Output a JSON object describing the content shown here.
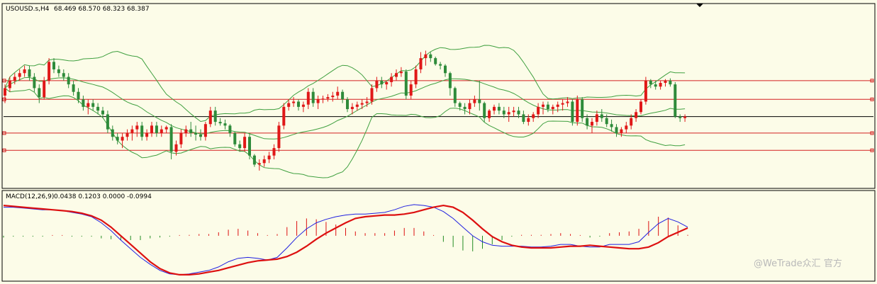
{
  "header": {
    "symbol": "USOUSD.s,H4",
    "ohlc": "68.469 68.570 68.323 68.387"
  },
  "indicator": {
    "title": "MACD(12,26,9)",
    "values": "0.0438 0.1203 0.0000 -0.0994"
  },
  "watermark": {
    "text": "@WeTrade众汇 官方"
  },
  "colors": {
    "background": "#fcfce8",
    "bull": "#e01818",
    "bear": "#2e8b3a",
    "bollinger": "#40a040",
    "level_line": "#d42020",
    "current_line": "#000000",
    "macd_main": "#2020e0",
    "macd_signal": "#dd1010",
    "hist_pos": "#dd1010",
    "hist_neg": "#228b22"
  },
  "chart_data": [
    {
      "type": "candlestick",
      "title": "USOUSD.s,H4",
      "ylim": [
        67.6,
        70.0
      ],
      "levels": [
        69.0,
        68.75,
        68.3,
        68.07
      ],
      "current_price": 68.52,
      "candles": [
        [
          68.8,
          68.95,
          68.7,
          68.9
        ],
        [
          68.9,
          69.05,
          68.85,
          69.0
        ],
        [
          69.0,
          69.1,
          68.95,
          69.05
        ],
        [
          69.05,
          69.15,
          69.0,
          69.1
        ],
        [
          69.1,
          69.2,
          69.05,
          69.15
        ],
        [
          69.15,
          69.2,
          69.0,
          69.05
        ],
        [
          69.05,
          69.1,
          68.85,
          68.9
        ],
        [
          68.9,
          68.95,
          68.7,
          68.78
        ],
        [
          68.78,
          69.05,
          68.75,
          69.0
        ],
        [
          69.0,
          69.3,
          68.95,
          69.25
        ],
        [
          69.25,
          69.3,
          69.1,
          69.15
        ],
        [
          69.15,
          69.2,
          69.05,
          69.1
        ],
        [
          69.1,
          69.15,
          69.0,
          69.05
        ],
        [
          69.05,
          69.1,
          68.9,
          68.95
        ],
        [
          68.95,
          69.0,
          68.8,
          68.85
        ],
        [
          68.85,
          68.9,
          68.7,
          68.75
        ],
        [
          68.75,
          68.8,
          68.6,
          68.65
        ],
        [
          68.65,
          68.75,
          68.55,
          68.7
        ],
        [
          68.7,
          68.75,
          68.6,
          68.65
        ],
        [
          68.65,
          68.7,
          68.55,
          68.6
        ],
        [
          68.6,
          68.65,
          68.5,
          68.55
        ],
        [
          68.55,
          68.6,
          68.3,
          68.35
        ],
        [
          68.35,
          68.4,
          68.2,
          68.25
        ],
        [
          68.25,
          68.3,
          68.15,
          68.2
        ],
        [
          68.2,
          68.3,
          68.1,
          68.25
        ],
        [
          68.25,
          68.35,
          68.2,
          68.3
        ],
        [
          68.3,
          68.4,
          68.2,
          68.35
        ],
        [
          68.35,
          68.45,
          68.25,
          68.4
        ],
        [
          68.4,
          68.45,
          68.2,
          68.25
        ],
        [
          68.25,
          68.35,
          68.2,
          68.3
        ],
        [
          68.3,
          68.45,
          68.25,
          68.4
        ],
        [
          68.4,
          68.45,
          68.25,
          68.3
        ],
        [
          68.3,
          68.4,
          68.25,
          68.35
        ],
        [
          68.35,
          68.4,
          68.3,
          68.38
        ],
        [
          68.38,
          68.42,
          67.95,
          68.05
        ],
        [
          68.05,
          68.2,
          68.0,
          68.15
        ],
        [
          68.15,
          68.35,
          68.1,
          68.3
        ],
        [
          68.3,
          68.4,
          68.25,
          68.35
        ],
        [
          68.35,
          68.45,
          68.25,
          68.3
        ],
        [
          68.3,
          68.4,
          68.2,
          68.28
        ],
        [
          68.28,
          68.35,
          68.2,
          68.25
        ],
        [
          68.25,
          68.45,
          68.2,
          68.42
        ],
        [
          68.42,
          68.65,
          68.38,
          68.6
        ],
        [
          68.6,
          68.65,
          68.4,
          68.45
        ],
        [
          68.45,
          68.5,
          68.4,
          68.43
        ],
        [
          68.43,
          68.48,
          68.35,
          68.4
        ],
        [
          68.4,
          68.42,
          68.25,
          68.3
        ],
        [
          68.3,
          68.32,
          68.12,
          68.15
        ],
        [
          68.15,
          68.2,
          68.05,
          68.1
        ],
        [
          68.1,
          68.3,
          68.05,
          68.25
        ],
        [
          68.25,
          68.3,
          67.95,
          68.0
        ],
        [
          68.0,
          68.02,
          67.85,
          67.88
        ],
        [
          67.88,
          67.95,
          67.8,
          67.9
        ],
        [
          67.9,
          68.0,
          67.85,
          67.95
        ],
        [
          67.95,
          68.05,
          67.9,
          68.0
        ],
        [
          68.0,
          68.15,
          67.95,
          68.1
        ],
        [
          68.1,
          68.45,
          68.05,
          68.4
        ],
        [
          68.4,
          68.7,
          68.35,
          68.65
        ],
        [
          68.65,
          68.75,
          68.6,
          68.7
        ],
        [
          68.7,
          68.78,
          68.65,
          68.72
        ],
        [
          68.72,
          68.75,
          68.6,
          68.65
        ],
        [
          68.65,
          68.72,
          68.58,
          68.68
        ],
        [
          68.68,
          68.9,
          68.62,
          68.85
        ],
        [
          68.85,
          68.9,
          68.65,
          68.7
        ],
        [
          68.7,
          68.8,
          68.62,
          68.75
        ],
        [
          68.75,
          68.8,
          68.7,
          68.76
        ],
        [
          68.76,
          68.82,
          68.72,
          68.78
        ],
        [
          68.78,
          68.85,
          68.72,
          68.8
        ],
        [
          68.8,
          68.92,
          68.75,
          68.85
        ],
        [
          68.85,
          68.88,
          68.7,
          68.75
        ],
        [
          68.75,
          68.78,
          68.58,
          68.62
        ],
        [
          68.62,
          68.7,
          68.55,
          68.65
        ],
        [
          68.65,
          68.72,
          68.6,
          68.68
        ],
        [
          68.68,
          68.75,
          68.62,
          68.7
        ],
        [
          68.7,
          68.78,
          68.65,
          68.72
        ],
        [
          68.72,
          68.95,
          68.68,
          68.9
        ],
        [
          68.9,
          69.05,
          68.85,
          69.0
        ],
        [
          69.0,
          69.05,
          68.9,
          68.95
        ],
        [
          68.95,
          69.0,
          68.88,
          68.98
        ],
        [
          68.98,
          69.1,
          68.92,
          69.05
        ],
        [
          69.05,
          69.15,
          69.0,
          69.1
        ],
        [
          69.1,
          69.18,
          69.05,
          69.12
        ],
        [
          69.12,
          69.15,
          68.75,
          68.8
        ],
        [
          68.8,
          69.0,
          68.75,
          68.95
        ],
        [
          68.95,
          69.2,
          68.9,
          69.15
        ],
        [
          69.15,
          69.38,
          69.1,
          69.3
        ],
        [
          69.3,
          69.4,
          69.2,
          69.35
        ],
        [
          69.35,
          69.38,
          69.25,
          69.3
        ],
        [
          69.3,
          69.32,
          69.2,
          69.22
        ],
        [
          69.22,
          69.25,
          69.15,
          69.2
        ],
        [
          69.2,
          69.22,
          69.05,
          69.1
        ],
        [
          69.1,
          69.12,
          68.8,
          68.9
        ],
        [
          68.9,
          68.92,
          68.65,
          68.7
        ],
        [
          68.7,
          68.72,
          68.6,
          68.65
        ],
        [
          68.65,
          68.7,
          68.55,
          68.62
        ],
        [
          68.62,
          68.75,
          68.55,
          68.7
        ],
        [
          68.7,
          68.8,
          68.65,
          68.75
        ],
        [
          68.75,
          69.0,
          68.6,
          68.7
        ],
        [
          68.7,
          68.72,
          68.45,
          68.5
        ],
        [
          68.5,
          68.62,
          68.45,
          68.6
        ],
        [
          68.6,
          68.68,
          68.55,
          68.65
        ],
        [
          68.65,
          68.7,
          68.55,
          68.6
        ],
        [
          68.6,
          68.65,
          68.5,
          68.55
        ],
        [
          68.55,
          68.65,
          68.45,
          68.58
        ],
        [
          68.58,
          68.65,
          68.52,
          68.6
        ],
        [
          68.6,
          68.65,
          68.5,
          68.55
        ],
        [
          68.55,
          68.6,
          68.42,
          68.45
        ],
        [
          68.45,
          68.55,
          68.4,
          68.5
        ],
        [
          68.5,
          68.58,
          68.45,
          68.55
        ],
        [
          68.55,
          68.7,
          68.5,
          68.65
        ],
        [
          68.65,
          68.72,
          68.55,
          68.68
        ],
        [
          68.68,
          68.72,
          68.58,
          68.62
        ],
        [
          68.62,
          68.68,
          68.55,
          68.65
        ],
        [
          68.65,
          68.72,
          68.58,
          68.68
        ],
        [
          68.68,
          68.75,
          68.6,
          68.7
        ],
        [
          68.7,
          68.78,
          68.65,
          68.72
        ],
        [
          68.72,
          68.75,
          68.4,
          68.45
        ],
        [
          68.45,
          68.8,
          68.4,
          68.75
        ],
        [
          68.75,
          68.78,
          68.45,
          68.5
        ],
        [
          68.5,
          68.55,
          68.35,
          68.4
        ],
        [
          68.4,
          68.5,
          68.3,
          68.45
        ],
        [
          68.45,
          68.6,
          68.4,
          68.55
        ],
        [
          68.55,
          68.62,
          68.45,
          68.5
        ],
        [
          68.5,
          68.55,
          68.38,
          68.42
        ],
        [
          68.42,
          68.48,
          68.32,
          68.38
        ],
        [
          68.38,
          68.42,
          68.25,
          68.3
        ],
        [
          68.3,
          68.38,
          68.25,
          68.35
        ],
        [
          68.35,
          68.45,
          68.3,
          68.4
        ],
        [
          68.4,
          68.55,
          68.35,
          68.5
        ],
        [
          68.5,
          68.62,
          68.45,
          68.58
        ],
        [
          68.58,
          68.75,
          68.55,
          68.72
        ],
        [
          68.72,
          69.05,
          68.68,
          69.0
        ],
        [
          69.0,
          69.02,
          68.9,
          68.95
        ],
        [
          68.95,
          69.0,
          68.88,
          68.92
        ],
        [
          68.92,
          69.0,
          68.88,
          68.97
        ],
        [
          68.97,
          69.02,
          68.92,
          69.0
        ],
        [
          69.0,
          69.03,
          68.92,
          68.95
        ],
        [
          68.95,
          68.98,
          68.5,
          68.52
        ],
        [
          68.52,
          68.55,
          68.45,
          68.5
        ],
        [
          68.5,
          68.55,
          68.45,
          68.52
        ]
      ]
    },
    {
      "type": "line",
      "title": "MACD(12,26,9)",
      "ylim": [
        -0.5,
        0.4
      ],
      "main": [
        0.33,
        0.33,
        0.32,
        0.31,
        0.3,
        0.3,
        0.29,
        0.27,
        0.25,
        0.22,
        0.15,
        0.06,
        -0.05,
        -0.15,
        -0.25,
        -0.33,
        -0.4,
        -0.44,
        -0.45,
        -0.44,
        -0.42,
        -0.4,
        -0.36,
        -0.3,
        -0.26,
        -0.25,
        -0.26,
        -0.28,
        -0.25,
        -0.14,
        -0.02,
        0.08,
        0.15,
        0.19,
        0.22,
        0.24,
        0.25,
        0.25,
        0.26,
        0.27,
        0.3,
        0.34,
        0.36,
        0.35,
        0.33,
        0.28,
        0.2,
        0.1,
        0.0,
        -0.07,
        -0.11,
        -0.12,
        -0.12,
        -0.12,
        -0.13,
        -0.13,
        -0.12,
        -0.1,
        -0.1,
        -0.12,
        -0.13,
        -0.13,
        -0.1,
        -0.1,
        -0.1,
        -0.07,
        0.04,
        0.14,
        0.2,
        0.16,
        0.1
      ],
      "signal": [
        0.35,
        0.34,
        0.33,
        0.32,
        0.31,
        0.3,
        0.29,
        0.28,
        0.26,
        0.23,
        0.18,
        0.1,
        0.0,
        -0.1,
        -0.2,
        -0.3,
        -0.38,
        -0.43,
        -0.45,
        -0.45,
        -0.44,
        -0.42,
        -0.4,
        -0.37,
        -0.34,
        -0.31,
        -0.29,
        -0.28,
        -0.27,
        -0.24,
        -0.19,
        -0.12,
        -0.04,
        0.03,
        0.09,
        0.15,
        0.2,
        0.22,
        0.23,
        0.24,
        0.24,
        0.25,
        0.27,
        0.3,
        0.33,
        0.35,
        0.33,
        0.27,
        0.18,
        0.08,
        -0.01,
        -0.07,
        -0.11,
        -0.13,
        -0.14,
        -0.14,
        -0.14,
        -0.13,
        -0.12,
        -0.12,
        -0.11,
        -0.12,
        -0.13,
        -0.14,
        -0.15,
        -0.15,
        -0.13,
        -0.08,
        -0.01,
        0.04,
        0.09
      ],
      "histogram": [
        -0.02,
        -0.01,
        -0.01,
        -0.01,
        -0.01,
        0.0,
        0.0,
        -0.01,
        -0.01,
        -0.01,
        -0.03,
        -0.04,
        -0.05,
        -0.05,
        -0.05,
        -0.03,
        -0.02,
        -0.01,
        0.0,
        0.01,
        0.02,
        0.02,
        0.04,
        0.07,
        0.08,
        0.06,
        0.03,
        0.0,
        0.02,
        0.1,
        0.17,
        0.2,
        0.19,
        0.16,
        0.13,
        0.09,
        0.05,
        0.03,
        0.03,
        0.03,
        0.06,
        0.09,
        0.09,
        0.05,
        0.0,
        -0.07,
        -0.13,
        -0.17,
        -0.18,
        -0.15,
        -0.1,
        -0.05,
        -0.01,
        0.01,
        0.01,
        0.01,
        0.02,
        0.03,
        0.02,
        0.0,
        -0.02,
        -0.01,
        0.03,
        0.04,
        0.05,
        0.08,
        0.17,
        0.22,
        0.21,
        0.12,
        0.01
      ],
      "zero_line": 0.0,
      "legend": []
    }
  ]
}
